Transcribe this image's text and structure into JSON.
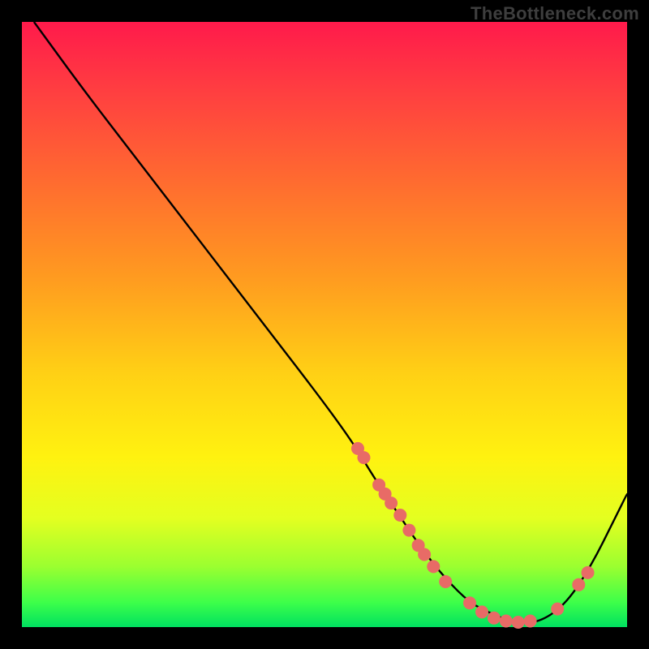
{
  "attribution": "TheBottleneck.com",
  "chart_data": {
    "type": "line",
    "title": "",
    "xlabel": "",
    "ylabel": "",
    "xlim": [
      0,
      100
    ],
    "ylim": [
      0,
      100
    ],
    "x": [
      2,
      10,
      20,
      30,
      40,
      50,
      55,
      58,
      62,
      66,
      70,
      74,
      78,
      82,
      86,
      90,
      94,
      98,
      100
    ],
    "values": [
      100,
      89,
      76,
      63,
      50,
      37,
      30,
      25,
      19,
      13,
      8,
      4,
      2,
      0.5,
      1,
      4,
      10,
      18,
      22
    ],
    "curve_color": "#000000",
    "markers": {
      "color": "#e86b66",
      "points": [
        {
          "x": 55.5,
          "y": 29.5
        },
        {
          "x": 56.5,
          "y": 28.0
        },
        {
          "x": 59.0,
          "y": 23.5
        },
        {
          "x": 60.0,
          "y": 22.0
        },
        {
          "x": 61.0,
          "y": 20.5
        },
        {
          "x": 62.5,
          "y": 18.5
        },
        {
          "x": 64.0,
          "y": 16.0
        },
        {
          "x": 65.5,
          "y": 13.5
        },
        {
          "x": 66.5,
          "y": 12.0
        },
        {
          "x": 68.0,
          "y": 10.0
        },
        {
          "x": 70.0,
          "y": 7.5
        },
        {
          "x": 74.0,
          "y": 4.0
        },
        {
          "x": 76.0,
          "y": 2.5
        },
        {
          "x": 78.0,
          "y": 1.5
        },
        {
          "x": 80.0,
          "y": 1.0
        },
        {
          "x": 82.0,
          "y": 0.8
        },
        {
          "x": 84.0,
          "y": 1.0
        },
        {
          "x": 88.5,
          "y": 3.0
        },
        {
          "x": 92.0,
          "y": 7.0
        },
        {
          "x": 93.5,
          "y": 9.0
        }
      ]
    }
  }
}
